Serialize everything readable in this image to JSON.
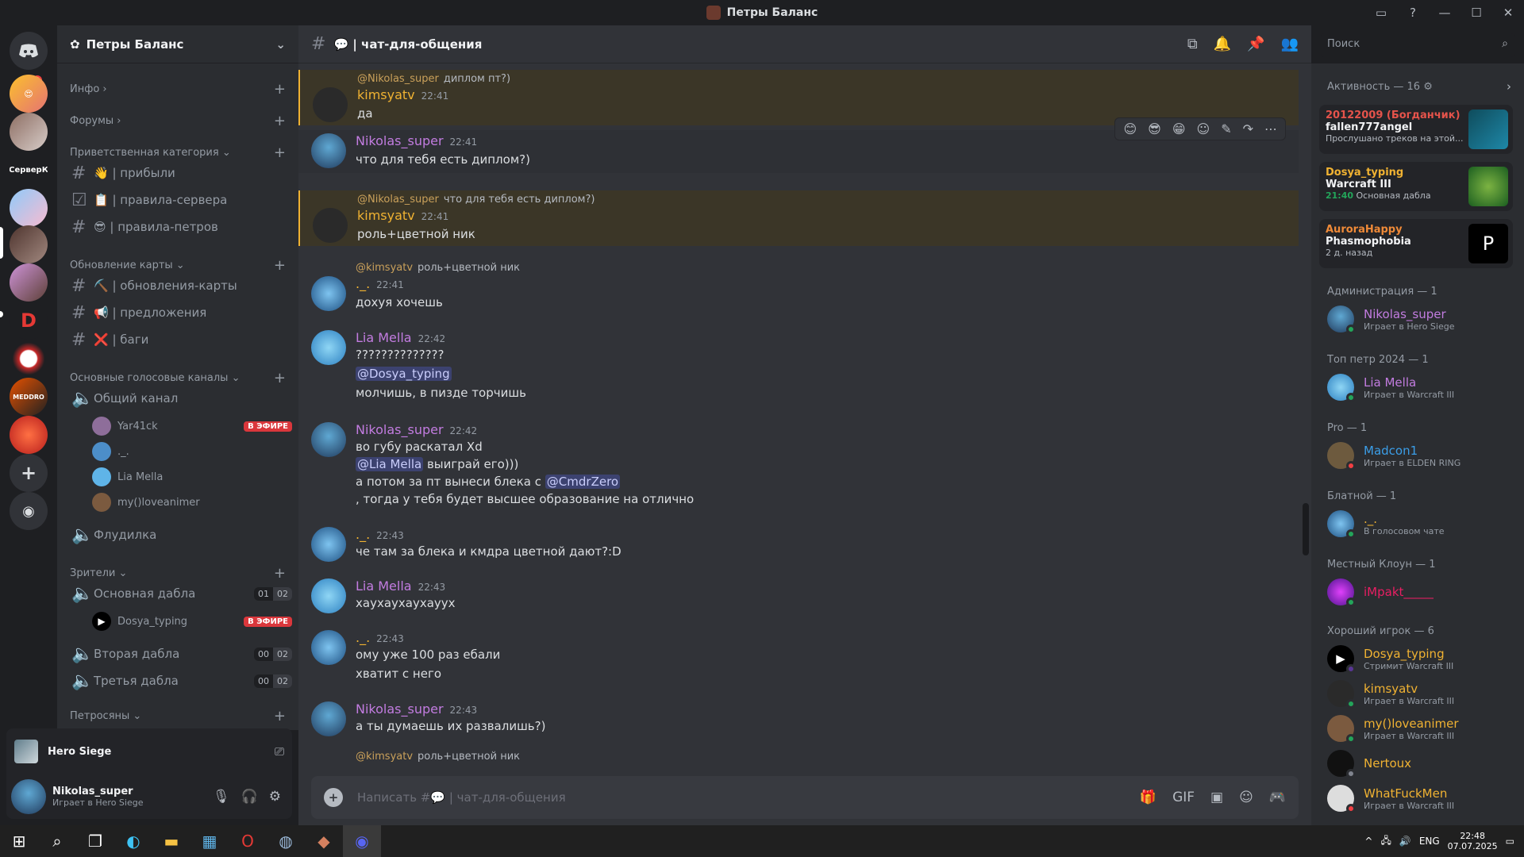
{
  "window": {
    "title": "Петры Баланс"
  },
  "server": {
    "name": "Петры Баланс",
    "categories": {
      "info": "Инфо",
      "forums": "Форумы",
      "welcome": "Приветственная категория",
      "map": "Обновление карты",
      "voice": "Основные голосовые каналы",
      "viewers": "Зрители",
      "petro": "Петросяны"
    },
    "channels": {
      "arrived": "👋 | прибыли",
      "rules": "📋 | правила-сервера",
      "petrov": "😎 | правила-петров",
      "mapupd": "⛏️ | обновления-карты",
      "suggest": "📢 | предложения",
      "bugs": "❌ | баги",
      "general_voice": "Общий канал",
      "flood": "Флудилка",
      "main_dabla": "Основная дабла",
      "second_dabla": "Вторая дабла",
      "third_dabla": "Третья дабла"
    },
    "voice_users": [
      "Yar41ck",
      "._.",
      "Lia Mella",
      "my()loveanimer"
    ],
    "dabla_user": "Dosya_typing",
    "live": "В ЭФИРЕ",
    "counts": {
      "main": [
        "01",
        "02"
      ],
      "second": [
        "00",
        "02"
      ],
      "third": [
        "00",
        "02"
      ]
    }
  },
  "activity": {
    "game": "Hero Siege"
  },
  "user": {
    "name": "Nikolas_super",
    "status": "Играет в Hero Siege"
  },
  "channel": {
    "name": "💬 | чат-для-общения"
  },
  "search": {
    "placeholder": "Поиск"
  },
  "composer": {
    "placeholder": "Написать #💬 | чат-для-общения"
  },
  "messages": [
    {
      "reply_name": "@Nikolas_super",
      "reply_text": "диплом пт?)",
      "author": "kimsyatv",
      "time": "22:41",
      "text": "да"
    },
    {
      "author": "Nikolas_super",
      "time": "22:41",
      "text": "что для тебя есть диплом?)"
    },
    {
      "reply_name": "@Nikolas_super",
      "reply_text": "что для тебя есть диплом?)",
      "author": "kimsyatv",
      "time": "22:41",
      "text": "роль+цветной ник"
    },
    {
      "reply_name": "@kimsyatv",
      "reply_text": "роль+цветной ник",
      "author": "._.",
      "time": "22:41",
      "text": "дохуя хочешь"
    },
    {
      "author": "Lia Mella",
      "time": "22:42",
      "text": "??????????????",
      "mention": "@Dosya_typing",
      "text2": "молчишь, в пизде торчишь"
    },
    {
      "author": "Nikolas_super",
      "time": "22:42",
      "text": "во губу раскатал Xd",
      "mention": "@Lia Mella",
      "text2": "выиграй его)))",
      "text3": "а потом за пт вынеси блека с",
      "mention2": "@CmdrZero",
      "text4": ", тогда у тебя будет высшее образование на отлично"
    },
    {
      "author": "._.",
      "time": "22:43",
      "text": "че там за блека и кмдра цветной дают?:D"
    },
    {
      "author": "Lia Mella",
      "time": "22:43",
      "text": "хаухаухаухауух"
    },
    {
      "author": "._.",
      "time": "22:43",
      "text": "ому уже 100 раз ебали",
      "text2": "хватит с него"
    },
    {
      "author": "Nikolas_super",
      "time": "22:43",
      "text": "а ты думаешь их развалишь?)"
    },
    {
      "reply_name": "@kimsyatv",
      "reply_text": "роль+цветной ник"
    }
  ],
  "members": {
    "activity_title": "Активность — 16",
    "cards": [
      {
        "t1": "20122009 (Богданчик)",
        "t2": "fallen777angel",
        "t3": "Прослушано треков на этой..."
      },
      {
        "t1": "Dosya_typing",
        "t2": "Warcraft III",
        "t3": "21:40",
        "t4": "Основная дабла"
      },
      {
        "t1": "AuroraHappy",
        "t2": "Phasmophobia",
        "t3": "2 д. назад"
      }
    ],
    "sections": [
      "Администрация — 1",
      "Топ петр 2024 — 1",
      "Pro — 1",
      "Блатной — 1",
      "Местный Клоун — 1",
      "Хороший игрок — 6"
    ],
    "list": [
      {
        "name": "Nikolas_super",
        "status": "Играет в Hero Siege",
        "color": "#c27ce0"
      },
      {
        "name": "Lia Mella",
        "status": "Играет в Warcraft III",
        "color": "#c27ce0"
      },
      {
        "name": "Madcon1",
        "status": "Играет в ELDEN RING",
        "color": "#3b9ee8"
      },
      {
        "name": "._.",
        "status": "В голосовом чате",
        "color": "#f0b232"
      },
      {
        "name": "iMpakt_____",
        "status": "",
        "color": "#e91e63"
      },
      {
        "name": "Dosya_typing",
        "status": "Стримит Warcraft III",
        "color": "#f0b232"
      },
      {
        "name": "kimsyatv",
        "status": "Играет в Warcraft III",
        "color": "#f0b232"
      },
      {
        "name": "my()loveanimer",
        "status": "Играет в Warcraft III",
        "color": "#f0b232"
      },
      {
        "name": "Nertoux",
        "status": "",
        "color": "#f0b232"
      },
      {
        "name": "WhatFuckMen",
        "status": "Играет в Warcraft III",
        "color": "#f0b232"
      }
    ]
  },
  "taskbar": {
    "lang": "ENG",
    "time": "22:48",
    "date": "07.07.2025"
  },
  "colors": {
    "kimsyatv": "#f0b232",
    "nikolas": "#c27ce0",
    "dots": "#f0b232",
    "lia": "#c27ce0"
  }
}
